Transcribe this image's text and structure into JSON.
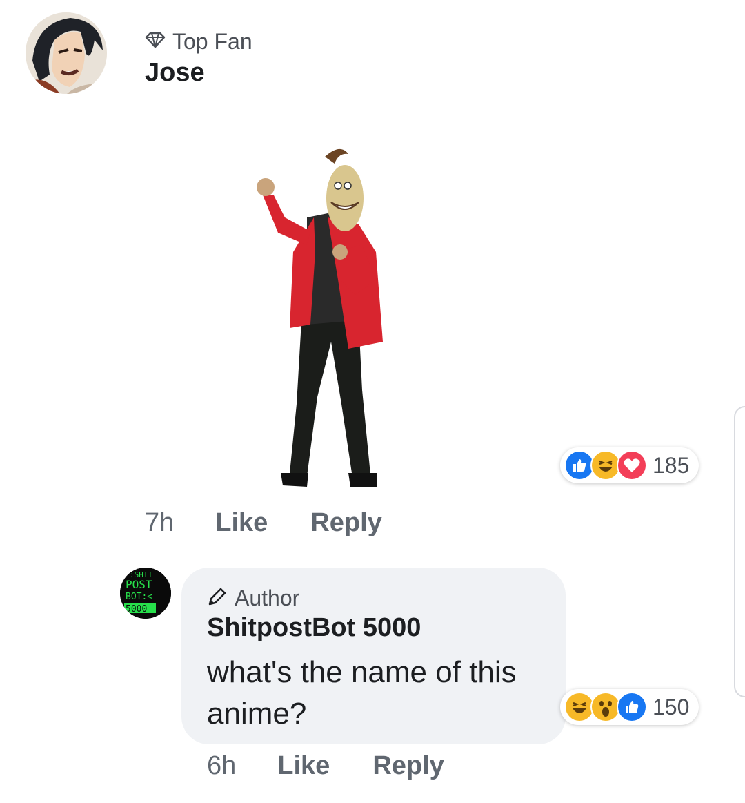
{
  "comment": {
    "badge_label": "Top Fan",
    "author_name": "Jose",
    "time": "7h",
    "like_label": "Like",
    "reply_label": "Reply",
    "reaction_count": "185",
    "reactions": [
      "like-icon",
      "haha-icon",
      "love-icon"
    ]
  },
  "reply": {
    "badge_label": "Author",
    "author_name": "ShitpostBot 5000",
    "message": "what's the name of this anime?",
    "time": "6h",
    "like_label": "Like",
    "reply_label": "Reply",
    "reaction_count": "150",
    "reactions": [
      "haha-icon",
      "wow-icon",
      "like-icon"
    ],
    "avatar_text": {
      "line1": ":SHIT",
      "line2": "POST",
      "line3": "BOT:<",
      "line4": "5000"
    }
  },
  "colors": {
    "like_blue": "#1877f2",
    "love_red": "#f33e58",
    "emoji_yellow": "#f7b928",
    "bubble_gray": "#f0f2f5",
    "meta_gray": "#606770"
  }
}
